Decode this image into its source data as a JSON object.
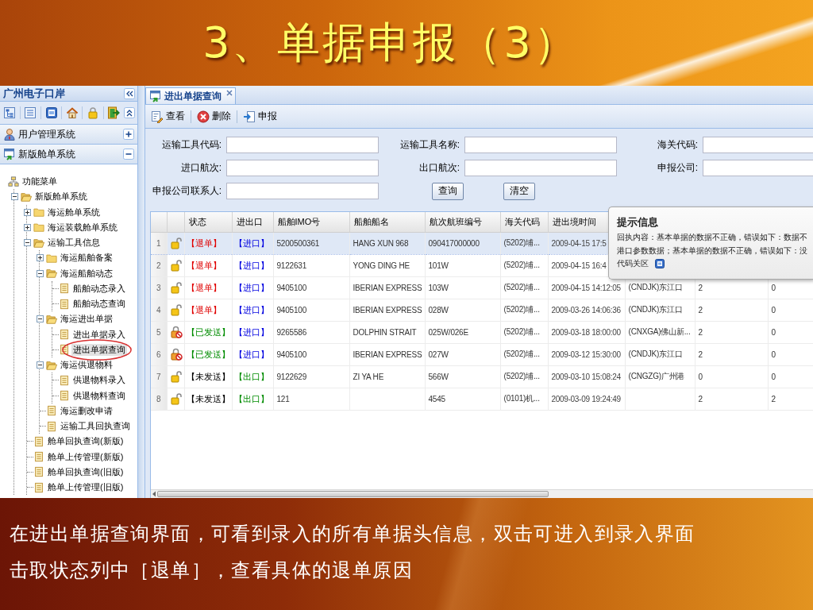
{
  "slide": {
    "title": "3、单据申报（3）",
    "notes": [
      "在进出单据查询界面，可看到录入的所有单据头信息，双击可进入到录入界面",
      "击取状态列中［退单］，查看具体的退单原因"
    ]
  },
  "sidebar": {
    "title": "广州电子口岸",
    "sections": [
      {
        "label": "用户管理系统",
        "expanded": false
      },
      {
        "label": "新版舱单系统",
        "expanded": true
      }
    ],
    "tree": {
      "label": "功能菜单",
      "kind": "root",
      "selected": false,
      "children": [
        {
          "label": "新版舱单系统",
          "kind": "folder",
          "expanded": true,
          "selected": false,
          "children": [
            {
              "label": "海运舱单系统",
              "kind": "folder",
              "expanded": false,
              "selected": false
            },
            {
              "label": "海运装载舱单系统",
              "kind": "folder",
              "expanded": false,
              "selected": false
            },
            {
              "label": "运输工具信息",
              "kind": "folder",
              "expanded": true,
              "selected": false,
              "children": [
                {
                  "label": "海运船舶备案",
                  "kind": "folder",
                  "expanded": false,
                  "selected": false
                },
                {
                  "label": "海运船舶动态",
                  "kind": "folder",
                  "expanded": true,
                  "selected": false,
                  "children": [
                    {
                      "label": "船舶动态录入",
                      "kind": "page",
                      "selected": false
                    },
                    {
                      "label": "船舶动态查询",
                      "kind": "page",
                      "selected": false
                    }
                  ]
                },
                {
                  "label": "海运进出单据",
                  "kind": "folder",
                  "expanded": true,
                  "selected": false,
                  "children": [
                    {
                      "label": "进出单据录入",
                      "kind": "page",
                      "selected": false
                    },
                    {
                      "label": "进出单据查询",
                      "kind": "page",
                      "selected": true
                    }
                  ]
                },
                {
                  "label": "海运供退物料",
                  "kind": "folder",
                  "expanded": true,
                  "selected": false,
                  "children": [
                    {
                      "label": "供退物料录入",
                      "kind": "page",
                      "selected": false
                    },
                    {
                      "label": "供退物料查询",
                      "kind": "page",
                      "selected": false
                    }
                  ]
                },
                {
                  "label": "海运删改申请",
                  "kind": "page",
                  "selected": false
                },
                {
                  "label": "运输工具回执查询",
                  "kind": "page",
                  "selected": false
                }
              ]
            },
            {
              "label": "舱单回执查询(新版)",
              "kind": "page",
              "selected": false
            },
            {
              "label": "舱单上传管理(新版)",
              "kind": "page",
              "selected": false
            },
            {
              "label": "舱单回执查询(旧版)",
              "kind": "page",
              "selected": false
            },
            {
              "label": "舱单上传管理(旧版)",
              "kind": "page",
              "selected": false
            }
          ]
        }
      ]
    }
  },
  "tabs": [
    {
      "label": "进出单据查询",
      "selected": true
    }
  ],
  "toolbar": [
    {
      "label": "查看",
      "kind": "view"
    },
    {
      "label": "删除",
      "kind": "delete"
    },
    {
      "label": "申报",
      "kind": "declare"
    }
  ],
  "form": {
    "rows": [
      [
        {
          "label": "运输工具代码:"
        },
        {
          "label": "运输工具名称:"
        },
        {
          "label": "海关代码:"
        }
      ],
      [
        {
          "label": "进口航次:"
        },
        {
          "label": "出口航次:"
        },
        {
          "label": "申报公司:"
        }
      ],
      [
        {
          "label": "申报公司联系人:"
        }
      ]
    ],
    "buttons": [
      {
        "label": "查询"
      },
      {
        "label": "清空"
      }
    ]
  },
  "table": {
    "columns": [
      "状态",
      "进出口",
      "船舶IMO号",
      "船舶船名",
      "航次航班编号",
      "海关代码",
      "进出境时间"
    ],
    "rows": [
      {
        "number": "1",
        "selected": true,
        "locked": false,
        "status": {
          "text": "【退单】",
          "kind": "returned"
        },
        "direction": {
          "text": "【进口】",
          "kind": "import"
        },
        "imo": "5200500361",
        "ship_name": "HANG XUN 968",
        "voyage": "090417000000",
        "customs": "(5202)埔...",
        "time": "2009-04-15 17:5"
      },
      {
        "number": "2",
        "selected": false,
        "locked": false,
        "status": {
          "text": "【退单】",
          "kind": "returned"
        },
        "direction": {
          "text": "【进口】",
          "kind": "import"
        },
        "imo": "9122631",
        "ship_name": "YONG DING HE",
        "voyage": "101W",
        "customs": "(5202)埔...",
        "time": "2009-04-15 16:4"
      },
      {
        "number": "3",
        "selected": false,
        "locked": false,
        "status": {
          "text": "【退单】",
          "kind": "returned"
        },
        "direction": {
          "text": "【进口】",
          "kind": "import"
        },
        "imo": "9405100",
        "ship_name": "IBERIAN EXPRESS",
        "voyage": "103W",
        "customs": "(5202)埔...",
        "time": "2009-04-15 14:12:05",
        "column_10": "(CNDJK)东江口",
        "column_11": "2",
        "column_12": "0"
      },
      {
        "number": "4",
        "selected": false,
        "locked": false,
        "status": {
          "text": "【退单】",
          "kind": "returned"
        },
        "direction": {
          "text": "【进口】",
          "kind": "import"
        },
        "imo": "9405100",
        "ship_name": "IBERIAN EXPRESS",
        "voyage": "028W",
        "customs": "(5202)埔...",
        "time": "2009-03-26 14:06:36",
        "column_10": "(CNDJK)东江口",
        "column_11": "2",
        "column_12": "0"
      },
      {
        "number": "5",
        "selected": false,
        "locked": true,
        "status": {
          "text": "【已发送】",
          "kind": "sent"
        },
        "direction": {
          "text": "【进口】",
          "kind": "import"
        },
        "imo": "9265586",
        "ship_name": "DOLPHIN STRAIT",
        "voyage": "025W/026E",
        "customs": "(5202)埔...",
        "time": "2009-03-18 18:00:00",
        "column_10": "(CNXGA)佛山新...",
        "column_11": "2",
        "column_12": "0"
      },
      {
        "number": "6",
        "selected": false,
        "locked": true,
        "status": {
          "text": "【已发送】",
          "kind": "sent"
        },
        "direction": {
          "text": "【进口】",
          "kind": "import"
        },
        "imo": "9405100",
        "ship_name": "IBERIAN EXPRESS",
        "voyage": "027W",
        "customs": "(5202)埔...",
        "time": "2009-03-12 15:30:00",
        "column_10": "(CNDJK)东江口",
        "column_11": "2",
        "column_12": "0"
      },
      {
        "number": "7",
        "selected": false,
        "locked": false,
        "status": {
          "text": "【未发送】",
          "kind": "unsent"
        },
        "direction": {
          "text": "【出口】",
          "kind": "export"
        },
        "imo": "9122629",
        "ship_name": "ZI YA HE",
        "voyage": "566W",
        "customs": "(5202)埔...",
        "time": "2009-03-10 15:08:24",
        "column_10": "(CNGZG)广州港",
        "column_11": "0",
        "column_12": "0"
      },
      {
        "number": "8",
        "selected": false,
        "locked": false,
        "status": {
          "text": "【未发送】",
          "kind": "unsent"
        },
        "direction": {
          "text": "【出口】",
          "kind": "export"
        },
        "imo": "121",
        "voyage": "4545",
        "customs": "(0101)机...",
        "time": "2009-03-09 19:24:49",
        "column_11": "2",
        "column_12": "2"
      }
    ]
  },
  "tooltip": {
    "title": "提示信息",
    "lines": [
      "回执内容：基本单据的数据不正确，错误如下：数据不",
      "港口参数数据；基本单据的数据不正确，错误如下：没",
      "代码关区"
    ]
  }
}
